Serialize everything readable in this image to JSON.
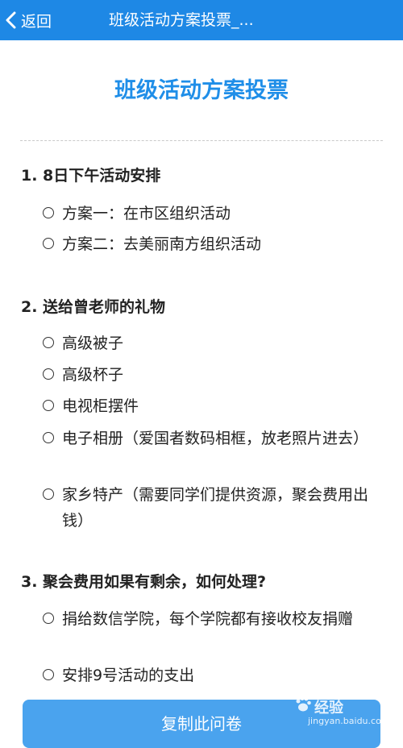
{
  "nav": {
    "back_label": "返回",
    "title": "班级活动方案投票_..."
  },
  "survey": {
    "title": "班级活动方案投票",
    "questions": [
      {
        "label": "1. 8日下午活动安排",
        "options": [
          "方案一：在市区组织活动",
          "方案二：去美丽南方组织活动"
        ]
      },
      {
        "label": "2. 送给曾老师的礼物",
        "options": [
          "高级被子",
          "高级杯子",
          "电视柜摆件",
          "电子相册（爱国者数码相框，放老照片进去）",
          "家乡特产（需要同学们提供资源，聚会费用出钱）"
        ]
      },
      {
        "label": "3. 聚会费用如果有剩余，如何处理?",
        "options": [
          "捐给数信学院，每个学院都有接收校友捐赠",
          "安排9号活动的支出"
        ]
      }
    ]
  },
  "footer": {
    "copy_button": "复制此问卷"
  },
  "watermark": {
    "logo": "经验",
    "url": "jingyan.baidu.com"
  },
  "colors": {
    "nav_bg": "#1e88e5",
    "title": "#1f8ee8",
    "button": "#4aa3ee"
  }
}
